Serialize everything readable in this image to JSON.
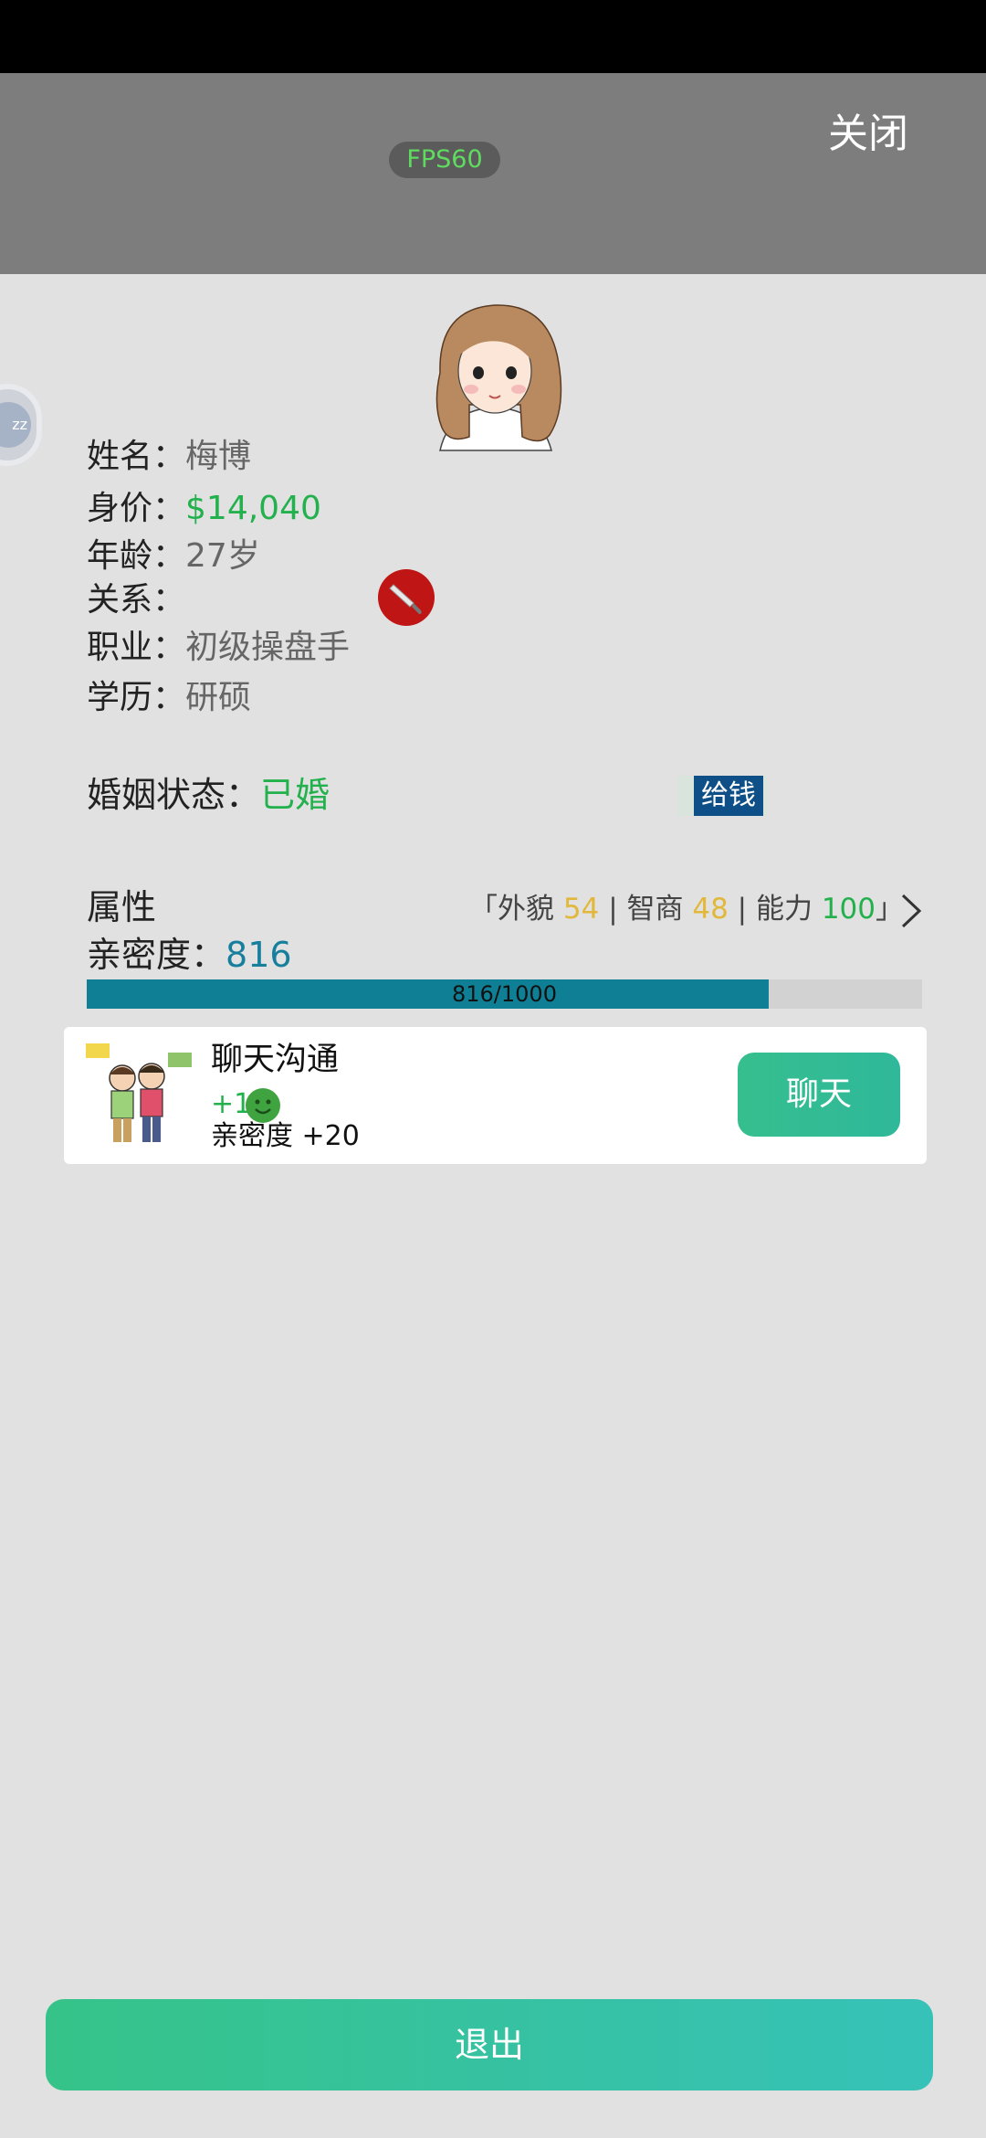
{
  "header": {
    "fps_label": "FPS60",
    "close_label": "关闭"
  },
  "floating": {
    "bubble_label": "zz"
  },
  "profile": {
    "name_key": "姓名：",
    "name_value": "梅博",
    "worth_key": "身价：",
    "worth_value": "$14,040",
    "age_key": "年龄：",
    "age_value": "27岁",
    "relation_key": "关系：",
    "relation_value": "",
    "job_key": "职业：",
    "job_value": "初级操盘手",
    "edu_key": "学历：",
    "edu_value": "研硕",
    "relation_icon": "knife-icon"
  },
  "marriage": {
    "key": "婚姻状态：",
    "value": "已婚",
    "give_money_label": "给钱"
  },
  "attributes": {
    "title": "属性",
    "open_bracket": "「外貌 ",
    "looks_value": "54",
    "sep1": " |  智商 ",
    "iq_value": "48",
    "sep2": " | 能力 ",
    "ability_value": "100",
    "close_bracket": "」"
  },
  "intimacy": {
    "key": "亲密度：",
    "value": "816",
    "progress_text": "816/1000",
    "progress_fraction": 0.816
  },
  "chat_card": {
    "title": "聊天沟通",
    "reward": "+1",
    "reward_icon": "smile-face-icon",
    "effect": "亲密度 +20",
    "button_label": "聊天"
  },
  "footer": {
    "exit_label": "退出"
  },
  "colors": {
    "accent_green": "#22b14c",
    "button_teal": "#36bf8e",
    "progress_fill": "#0f7f95",
    "give_money_bg": "#0d4f86"
  }
}
